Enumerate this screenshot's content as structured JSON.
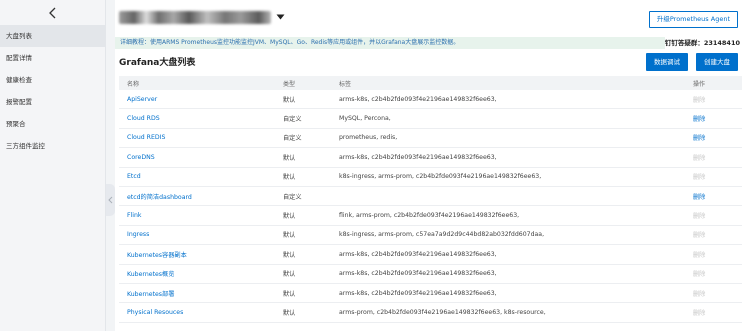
{
  "sidebar": {
    "items": [
      {
        "label": "大盘列表",
        "active": true
      },
      {
        "label": "配置详情",
        "active": false
      },
      {
        "label": "健康检查",
        "active": false
      },
      {
        "label": "报警配置",
        "active": false
      },
      {
        "label": "预聚合",
        "active": false
      },
      {
        "label": "三方组件监控",
        "active": false
      }
    ]
  },
  "header": {
    "upgrade_button": "升级Prometheus Agent"
  },
  "tip": {
    "text": "详细教程：使用ARMS Prometheus监控功能监控JVM、MySQL、Go、Redis等应用或组件，并以Grafana大盘展示监控数据。",
    "dingtalk": "钉钉答疑群：23148410"
  },
  "section": {
    "title": "Grafana大盘列表",
    "debug_button": "数据调试",
    "create_button": "创建大盘"
  },
  "table": {
    "headers": {
      "name": "名称",
      "type": "类型",
      "tags": "标签",
      "op": "操作"
    },
    "rows": [
      {
        "name": "ApiServer",
        "type": "默认",
        "tags": "arms-k8s, c2b4b2fde093f4e2196ae149832f6ee63,",
        "op": "删除",
        "op_enabled": false
      },
      {
        "name": "Cloud RDS",
        "type": "自定义",
        "tags": "MySQL, Percona,",
        "op": "删除",
        "op_enabled": true
      },
      {
        "name": "Cloud REDIS",
        "type": "自定义",
        "tags": "prometheus, redis,",
        "op": "删除",
        "op_enabled": true
      },
      {
        "name": "CoreDNS",
        "type": "默认",
        "tags": "arms-k8s, c2b4b2fde093f4e2196ae149832f6ee63,",
        "op": "删除",
        "op_enabled": false
      },
      {
        "name": "Etcd",
        "type": "默认",
        "tags": "k8s-ingress, arms-prom, c2b4b2fde093f4e2196ae149832f6ee63,",
        "op": "删除",
        "op_enabled": false
      },
      {
        "name": "etcd的简洁dashboard",
        "type": "自定义",
        "tags": "",
        "op": "删除",
        "op_enabled": true
      },
      {
        "name": "Flink",
        "type": "默认",
        "tags": "flink, arms-prom, c2b4b2fde093f4e2196ae149832f6ee63,",
        "op": "删除",
        "op_enabled": false
      },
      {
        "name": "Ingress",
        "type": "默认",
        "tags": "k8s-ingress, arms-prom, c57ea7a9d2d9c44bd82ab032fdd607daa,",
        "op": "删除",
        "op_enabled": false
      },
      {
        "name": "Kubernetes容器副本",
        "type": "默认",
        "tags": "arms-k8s, c2b4b2fde093f4e2196ae149832f6ee63,",
        "op": "删除",
        "op_enabled": false
      },
      {
        "name": "Kubernetes概览",
        "type": "默认",
        "tags": "arms-k8s, c2b4b2fde093f4e2196ae149832f6ee63,",
        "op": "删除",
        "op_enabled": false
      },
      {
        "name": "Kubernetes部署",
        "type": "默认",
        "tags": "arms-k8s, c2b4b2fde093f4e2196ae149832f6ee63,",
        "op": "删除",
        "op_enabled": false
      },
      {
        "name": "Physical Resouces",
        "type": "默认",
        "tags": "arms-prom, c2b4b2fde093f4e2196ae149832f6ee63, k8s-resource,",
        "op": "删除",
        "op_enabled": false
      }
    ]
  },
  "icons": {
    "back": "chevron-left-icon",
    "title_dropdown": "caret-down-icon",
    "collapse": "chevron-left-icon"
  },
  "colors": {
    "accent": "#0070cc",
    "tip_background": "#e7f3ec",
    "disabled_text": "#c6c6c6"
  }
}
